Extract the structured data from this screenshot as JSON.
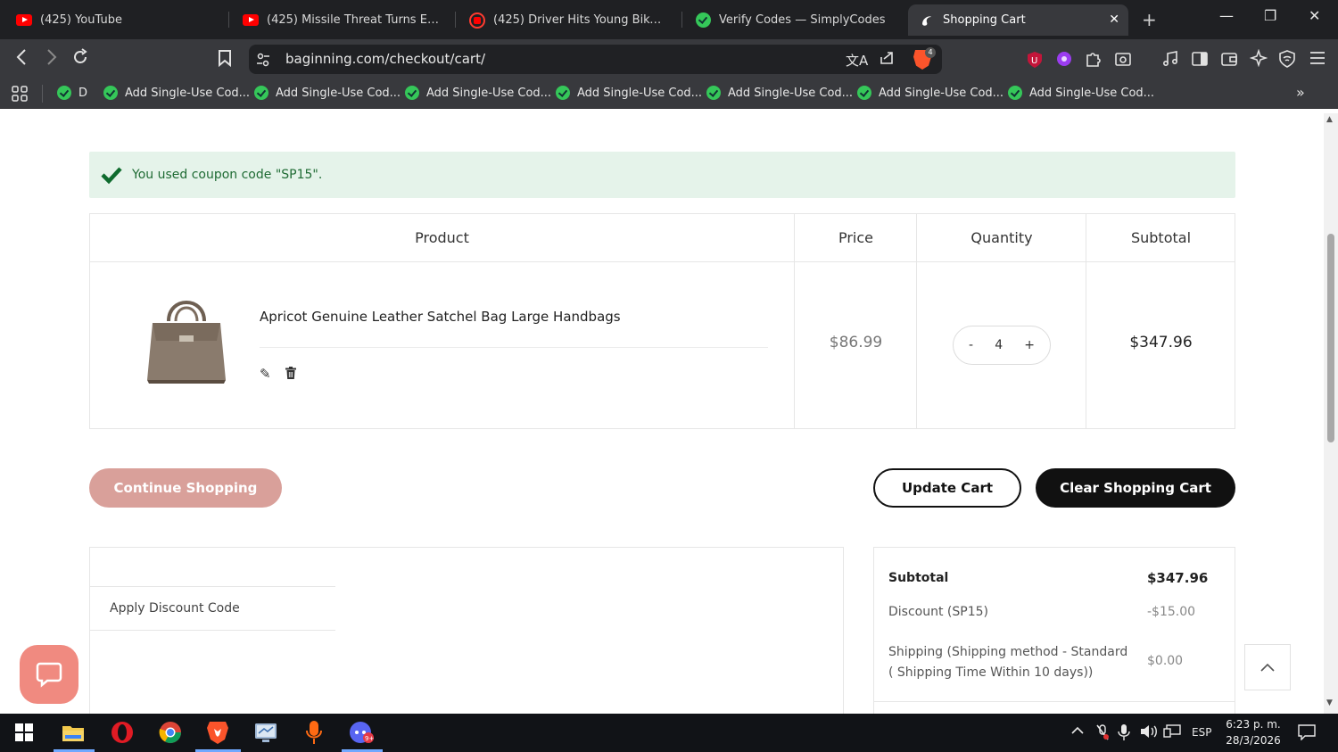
{
  "browser": {
    "tabs": [
      {
        "title": "(425) YouTube",
        "icon": "youtube-icon"
      },
      {
        "title": "(425) Missile Threat Turns Everythi",
        "icon": "youtube-icon"
      },
      {
        "title": "(425) Driver Hits Young Biker - You",
        "icon": "youtube-playing-icon"
      },
      {
        "title": "Verify Codes — SimplyCodes",
        "icon": "simplycodes-icon"
      },
      {
        "title": "Shopping Cart",
        "icon": "site-logo-icon",
        "active": true
      }
    ],
    "url": "baginning.com/checkout/cart/",
    "brave_shield_count": "4",
    "bookmarks": [
      "D",
      "Add Single-Use Cod...",
      "Add Single-Use Cod...",
      "Add Single-Use Cod...",
      "Add Single-Use Cod...",
      "Add Single-Use Cod...",
      "Add Single-Use Cod...",
      "Add Single-Use Cod..."
    ]
  },
  "page": {
    "alert": "You used coupon code \"SP15\".",
    "table": {
      "headers": [
        "Product",
        "Price",
        "Quantity",
        "Subtotal"
      ],
      "item": {
        "name": "Apricot Genuine Leather Satchel Bag Large Handbags",
        "price": "$86.99",
        "quantity": "4",
        "qty_minus": "-",
        "qty_plus": "+",
        "subtotal": "$347.96"
      }
    },
    "buttons": {
      "continue": "Continue Shopping",
      "update": "Update Cart",
      "clear": "Clear Shopping Cart"
    },
    "discount": {
      "label": "Apply Discount Code"
    },
    "summary": {
      "subtotal_label": "Subtotal",
      "subtotal_value": "$347.96",
      "discount_label": "Discount (SP15)",
      "discount_value": "-$15.00",
      "shipping_label": "Shipping (Shipping method - Standard ( Shipping Time Within 10 days))",
      "shipping_value": "$0.00"
    }
  },
  "taskbar": {
    "language": "ESP",
    "time": "6:23 p. m.",
    "date": "28/3/2026"
  },
  "colors": {
    "alert_bg": "#e5f3ea",
    "alert_text": "#1f6b34",
    "continue_btn": "#d9a09a",
    "dark_btn": "#111111",
    "chat_bubble": "#f08a80"
  }
}
